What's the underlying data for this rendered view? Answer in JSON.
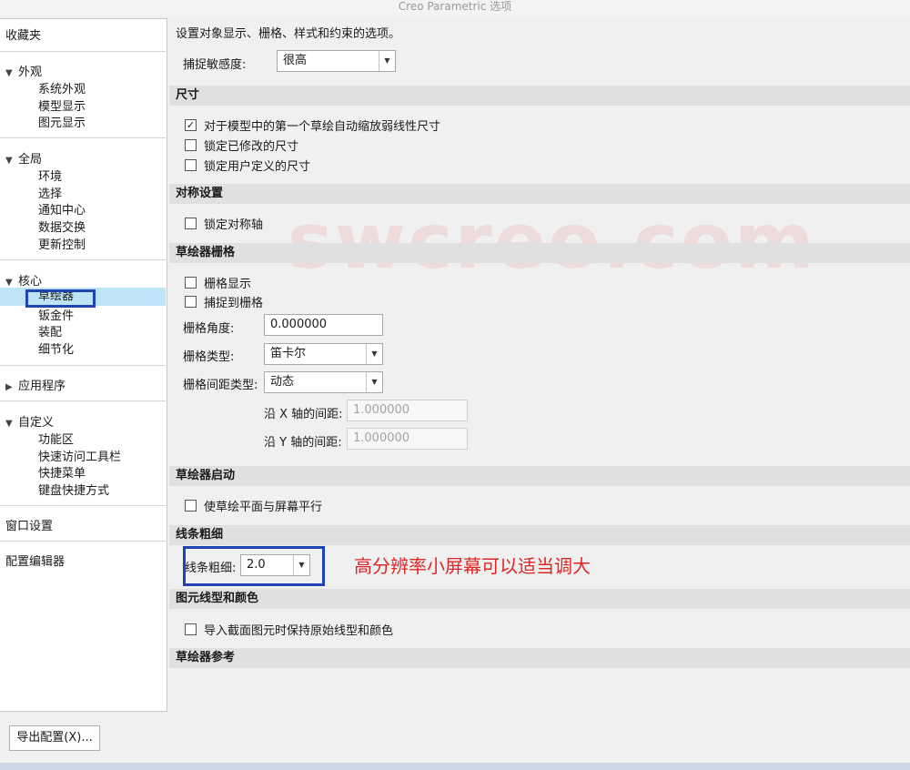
{
  "window": {
    "title": "Creo Parametric 选项"
  },
  "sidebar": {
    "favorites": "收藏夹",
    "groups": [
      {
        "label": "外观",
        "items": [
          "系统外观",
          "模型显示",
          "图元显示"
        ]
      },
      {
        "label": "全局",
        "items": [
          "环境",
          "选择",
          "通知中心",
          "数据交换",
          "更新控制"
        ]
      },
      {
        "label": "核心",
        "items": [
          "草绘器",
          "钣金件",
          "装配",
          "细节化"
        ]
      },
      {
        "label": "应用程序",
        "items": []
      },
      {
        "label": "自定义",
        "items": [
          "功能区",
          "快速访问工具栏",
          "快捷菜单",
          "键盘快捷方式"
        ]
      }
    ],
    "window_settings": "窗口设置",
    "config_editor": "配置编辑器"
  },
  "main": {
    "intro": "设置对象显示、栅格、样式和约束的选项。",
    "snap_sensitivity": {
      "label": "捕捉敏感度:",
      "value": "很高"
    },
    "sections": {
      "dimensions": {
        "title": "尺寸",
        "options": [
          {
            "label": "对于模型中的第一个草绘自动缩放弱线性尺寸",
            "checked": true
          },
          {
            "label": "锁定已修改的尺寸",
            "checked": false
          },
          {
            "label": "锁定用户定义的尺寸",
            "checked": false
          }
        ]
      },
      "symmetry": {
        "title": "对称设置",
        "options": [
          {
            "label": "锁定对称轴",
            "checked": false
          }
        ]
      },
      "grid": {
        "title": "草绘器栅格",
        "options": [
          {
            "label": "栅格显示",
            "checked": false
          },
          {
            "label": "捕捉到栅格",
            "checked": false
          }
        ],
        "angle_label": "栅格角度:",
        "angle_value": "0.000000",
        "type_label": "栅格类型:",
        "type_value": "笛卡尔",
        "spacing_type_label": "栅格间距类型:",
        "spacing_type_value": "动态",
        "x_spacing_label": "沿 X 轴的间距:",
        "x_spacing_value": "1.000000",
        "y_spacing_label": "沿 Y 轴的间距:",
        "y_spacing_value": "1.000000"
      },
      "startup": {
        "title": "草绘器启动",
        "options": [
          {
            "label": "使草绘平面与屏幕平行",
            "checked": false
          }
        ]
      },
      "line_thickness": {
        "title": "线条粗细",
        "label": "线条粗细:",
        "value": "2.0"
      },
      "line_style": {
        "title": "图元线型和颜色",
        "options": [
          {
            "label": "导入截面图元时保持原始线型和颜色",
            "checked": false
          }
        ]
      },
      "reference": {
        "title": "草绘器参考"
      }
    }
  },
  "annotation": {
    "text": "高分辨率小屏幕可以适当调大"
  },
  "watermark": "swcreo.com",
  "footer": {
    "export_label": "导出配置(X)..."
  },
  "colors": {
    "highlight_box": "#1f44b5",
    "annotation_text": "#e02525",
    "selected_row": "#bfe4f8"
  }
}
